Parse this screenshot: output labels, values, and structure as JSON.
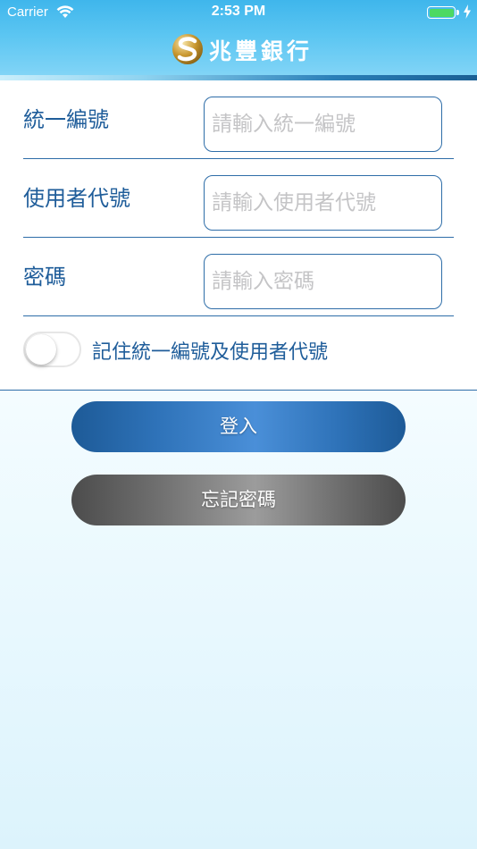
{
  "status_bar": {
    "carrier": "Carrier",
    "time": "2:53 PM",
    "battery_level_percent": 100,
    "battery_color": "#4cd964"
  },
  "header": {
    "brand_name": "兆豐銀行",
    "logo_icon": "megabank-logo-icon",
    "background_color": "#4dbdef"
  },
  "form": {
    "tax_id": {
      "label": "統一編號",
      "value": "",
      "placeholder": "請輸入統一編號"
    },
    "user_id": {
      "label": "使用者代號",
      "value": "",
      "placeholder": "請輸入使用者代號"
    },
    "password": {
      "label": "密碼",
      "value": "",
      "placeholder": "請輸入密碼"
    },
    "remember": {
      "label": "記住統一編號及使用者代號",
      "enabled": false
    }
  },
  "buttons": {
    "login_label": "登入",
    "forgot_label": "忘記密碼"
  },
  "colors": {
    "label_blue": "#1f5d9a",
    "border_blue": "#2e6da8",
    "login_button": "#2e72b8",
    "forgot_button": "#6e6e6e"
  }
}
